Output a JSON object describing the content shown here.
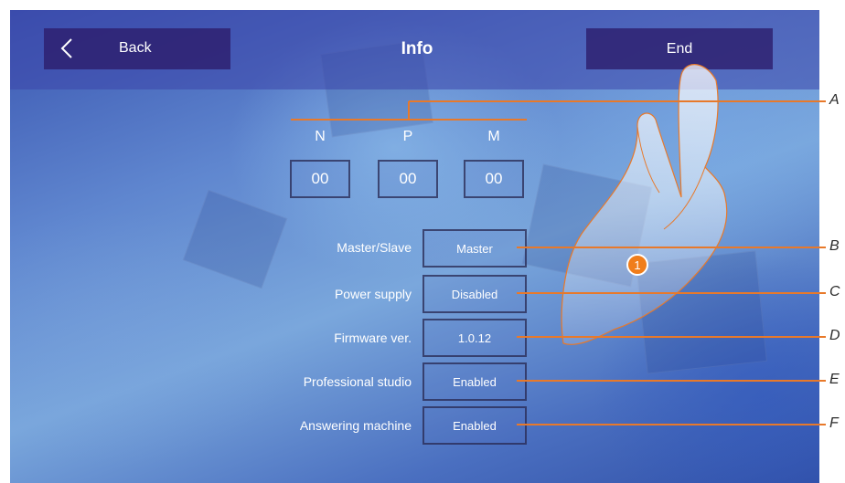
{
  "header": {
    "back_label": "Back",
    "title": "Info",
    "end_label": "End"
  },
  "address": {
    "columns": [
      {
        "label": "N",
        "value": "00"
      },
      {
        "label": "P",
        "value": "00"
      },
      {
        "label": "M",
        "value": "00"
      }
    ]
  },
  "settings": [
    {
      "label": "Master/Slave",
      "value": "Master"
    },
    {
      "label": "Power supply",
      "value": "Disabled"
    },
    {
      "label": "Firmware ver.",
      "value": "1.0.12"
    },
    {
      "label": "Professional studio",
      "value": "Enabled"
    },
    {
      "label": "Answering machine",
      "value": "Enabled"
    }
  ],
  "callouts": [
    "A",
    "B",
    "C",
    "D",
    "E",
    "F"
  ],
  "step_badge": "1",
  "colors": {
    "callout_line": "#e8792a",
    "badge": "#f07d1a",
    "topbar": "#3c46aa",
    "button": "#2d1e6e"
  },
  "icons": {
    "back": "chevron-left-icon",
    "hand": "pointing-hand-icon"
  }
}
